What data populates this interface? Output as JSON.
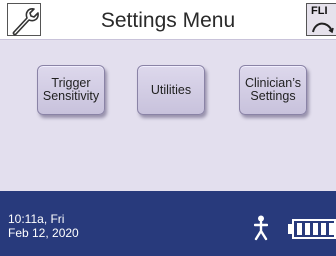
{
  "header": {
    "title": "Settings Menu",
    "left_icon": "wrench-icon",
    "right_badge": "FLI",
    "right_icon": "arc-icon"
  },
  "buttons": [
    {
      "label": "Trigger\nSensitivity"
    },
    {
      "label": "Utilities"
    },
    {
      "label": "Clinician’s\nSettings"
    }
  ],
  "footer": {
    "time_line1": "10:11a, Fri",
    "time_line2": "Feb 12, 2020",
    "patient_icon": "person-icon",
    "battery_icon": "battery-icon",
    "battery_level": 1.0
  },
  "colors": {
    "footer_bg": "#283a7c",
    "content_bg": "#e3dfee",
    "button_bg": "#d3cde6"
  }
}
